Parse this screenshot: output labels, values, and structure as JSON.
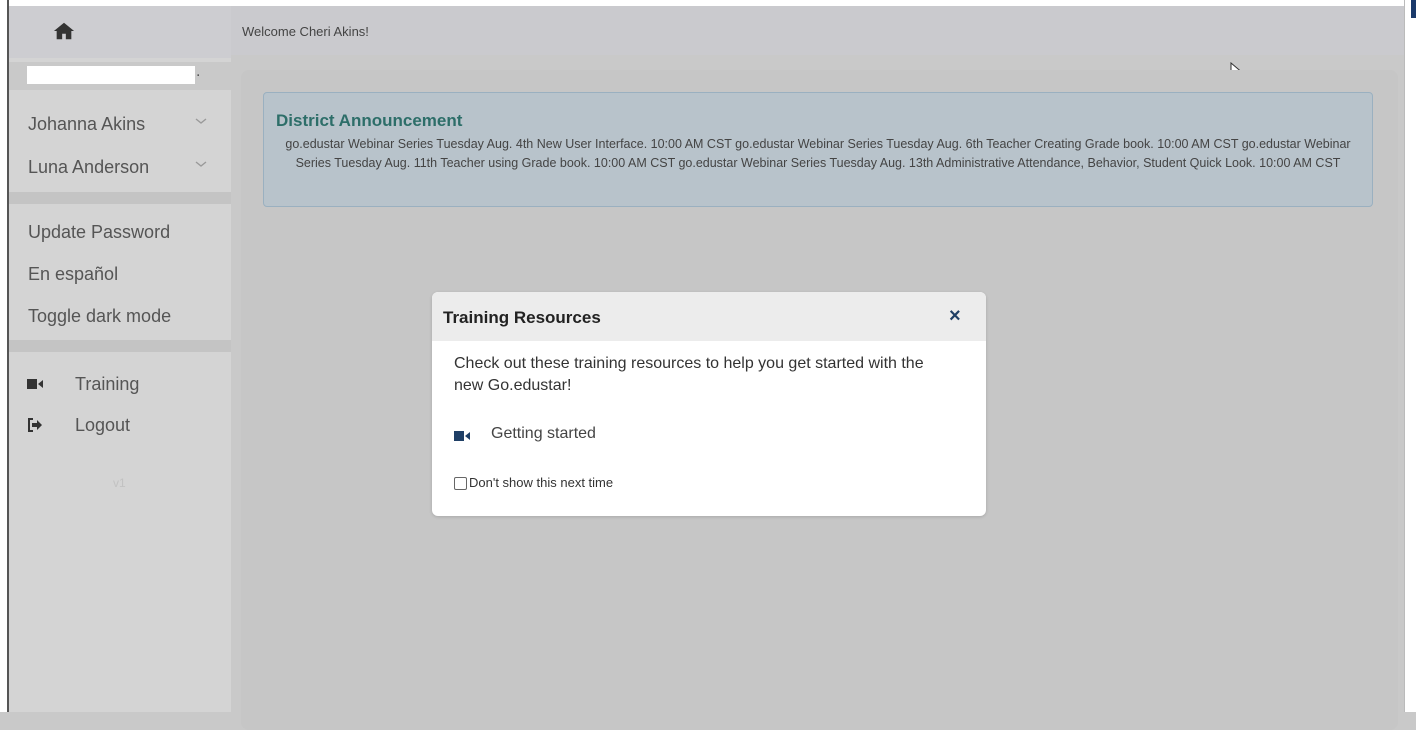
{
  "header": {
    "welcome": "Welcome Cheri Akins!"
  },
  "sidebar": {
    "home_icon": "home-icon",
    "students": [
      {
        "label": "Johanna Akins"
      },
      {
        "label": "Luna Anderson"
      }
    ],
    "links": [
      {
        "label": "Update Password"
      },
      {
        "label": "En español"
      },
      {
        "label": "Toggle dark mode"
      }
    ],
    "training": {
      "label": "Training",
      "icon": "video-camera-icon"
    },
    "logout": {
      "label": "Logout",
      "icon": "sign-out-icon"
    },
    "version": "v1"
  },
  "announcement": {
    "title": "District Announcement",
    "text": "go.edustar Webinar Series Tuesday Aug. 4th New User Interface. 10:00 AM CST go.edustar Webinar Series Tuesday Aug. 6th Teacher Creating Grade book. 10:00 AM CST go.edustar Webinar Series Tuesday Aug. 11th Teacher using Grade book. 10:00 AM CST go.edustar Webinar Series Tuesday Aug. 13th Administrative Attendance, Behavior, Student Quick Look. 10:00 AM CST"
  },
  "modal": {
    "title": "Training Resources",
    "close_glyph": "×",
    "body": "Check out these training resources to help you get started with the new Go.edustar!",
    "resource_link": "Getting started",
    "dont_show_label": "Don't show this next time"
  },
  "colors": {
    "accent": "#2d6e69",
    "sidebar_bg": "#d4d4d4",
    "header_bg": "#cacace",
    "announcement_bg": "#b8c3cb"
  }
}
